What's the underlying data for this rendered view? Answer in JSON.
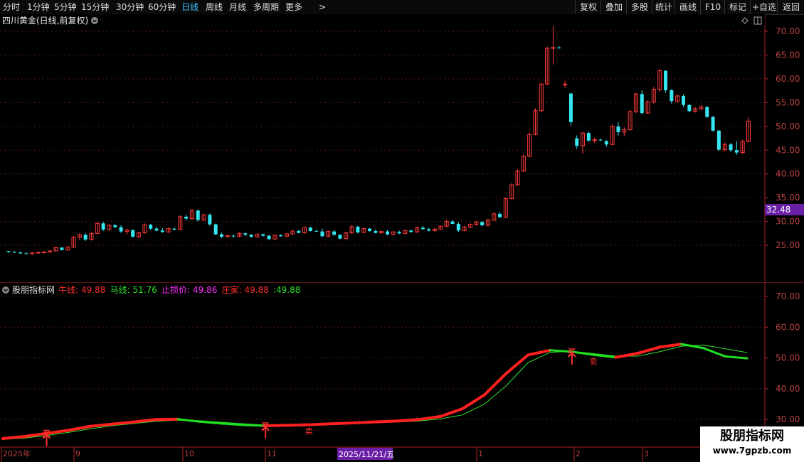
{
  "toolbar": {
    "periods": [
      "分时",
      "1分钟",
      "5分钟",
      "15分钟",
      "30分钟",
      "60分钟",
      "日线",
      "周线",
      "月线",
      "多周期",
      "更多"
    ],
    "active_period": "日线",
    "more_arrow": ">",
    "right_buttons": [
      "复权",
      "叠加",
      "多股",
      "统计",
      "画线",
      "F10",
      "+自选",
      "返回"
    ],
    "annotation_button": "标记"
  },
  "main_chart": {
    "title": "四川黄金(日线,前复权)",
    "price_label": "32.48",
    "y_ticks": [
      "70.00",
      "65.00",
      "60.00",
      "55.00",
      "50.00",
      "45.00",
      "40.00",
      "35.00",
      "30.00",
      "25.00"
    ],
    "colors": {
      "up": "#ff3b3b",
      "down": "#35e6f0",
      "grid": "#5a1515",
      "axis": "#b22222",
      "price_bg": "#6a1fa6"
    }
  },
  "indicator": {
    "name": "股朋指标网",
    "items": [
      {
        "label": "牛线:",
        "value": "49.88",
        "color": "#ff3030"
      },
      {
        "label": "马线:",
        "value": "51.76",
        "color": "#30e030"
      },
      {
        "label": "止损价:",
        "value": "49.86",
        "color": "#ff30ff"
      },
      {
        "label": "庄家:",
        "value": "49.88",
        "color": "#ff3030"
      },
      {
        "label": ":",
        "value": "49.88",
        "color": "#30e030"
      }
    ],
    "y_ticks": [
      "70.00",
      "60.00",
      "50.00",
      "40.00",
      "30.00"
    ],
    "buy_marks": [
      "买",
      "买",
      "买"
    ],
    "sell_marks": [
      "卖",
      "卖"
    ]
  },
  "x_axis": {
    "labels": [
      "2025年",
      "9",
      "10",
      "11",
      "1",
      "2",
      "3"
    ],
    "cursor_label": "2025/11/21/五"
  },
  "watermark": {
    "title": "股朋指标网",
    "url": "www.7gpzb.com"
  },
  "chart_data": [
    {
      "type": "candlestick",
      "title": "四川黄金(日线,前复权)",
      "x_labels": [
        "2025年",
        "9",
        "10",
        "11",
        "1",
        "2",
        "3"
      ],
      "ylim": [
        20,
        75
      ],
      "y_ticks": [
        25,
        30,
        35,
        40,
        45,
        50,
        55,
        60,
        65,
        70
      ],
      "last_price": 32.48,
      "candles": [
        [
          23.8,
          23.8,
          23.4,
          23.6
        ],
        [
          23.6,
          23.8,
          23.4,
          23.5
        ],
        [
          23.5,
          23.6,
          23.2,
          23.3
        ],
        [
          23.3,
          23.5,
          23.1,
          23.2
        ],
        [
          23.2,
          23.5,
          23.1,
          23.4
        ],
        [
          23.4,
          23.6,
          23.2,
          23.5
        ],
        [
          23.5,
          23.7,
          23.3,
          23.6
        ],
        [
          23.6,
          23.9,
          23.4,
          23.8
        ],
        [
          23.8,
          24.6,
          23.7,
          24.5
        ],
        [
          24.5,
          24.6,
          23.9,
          24.0
        ],
        [
          24.0,
          24.8,
          23.9,
          24.6
        ],
        [
          24.6,
          26.9,
          24.5,
          26.7
        ],
        [
          26.7,
          27.5,
          26.1,
          27.2
        ],
        [
          27.2,
          27.5,
          25.9,
          26.2
        ],
        [
          26.2,
          27.7,
          26.0,
          27.5
        ],
        [
          27.5,
          29.9,
          27.3,
          29.6
        ],
        [
          29.6,
          29.9,
          28.0,
          28.3
        ],
        [
          28.3,
          29.4,
          28.1,
          29.2
        ],
        [
          29.2,
          29.5,
          28.6,
          28.8
        ],
        [
          28.8,
          29.2,
          27.6,
          27.9
        ],
        [
          27.9,
          28.5,
          27.3,
          28.2
        ],
        [
          28.2,
          28.3,
          26.6,
          26.8
        ],
        [
          26.8,
          27.8,
          26.5,
          27.6
        ],
        [
          27.6,
          29.6,
          27.4,
          29.3
        ],
        [
          29.3,
          29.5,
          28.2,
          28.5
        ],
        [
          28.5,
          28.9,
          27.9,
          28.1
        ],
        [
          28.1,
          28.6,
          27.6,
          27.8
        ],
        [
          27.8,
          28.7,
          27.6,
          28.5
        ],
        [
          28.5,
          28.7,
          28.1,
          28.3
        ],
        [
          28.3,
          31.3,
          28.2,
          31.0
        ],
        [
          31.0,
          31.4,
          30.2,
          30.6
        ],
        [
          30.6,
          32.6,
          30.4,
          32.3
        ],
        [
          32.3,
          32.5,
          30.0,
          30.3
        ],
        [
          30.3,
          31.6,
          30.1,
          31.4
        ],
        [
          31.4,
          31.7,
          29.1,
          29.4
        ],
        [
          29.4,
          29.6,
          27.1,
          27.3
        ],
        [
          27.3,
          27.7,
          26.5,
          26.8
        ],
        [
          26.8,
          27.2,
          26.6,
          27.0
        ],
        [
          27.0,
          27.3,
          26.6,
          26.9
        ],
        [
          26.9,
          27.7,
          26.7,
          27.5
        ],
        [
          27.5,
          27.7,
          26.9,
          27.2
        ],
        [
          27.2,
          27.3,
          26.6,
          26.8
        ],
        [
          26.8,
          27.5,
          26.6,
          27.3
        ],
        [
          27.3,
          27.5,
          26.8,
          27.0
        ],
        [
          27.0,
          27.2,
          26.1,
          26.3
        ],
        [
          26.3,
          27.3,
          26.2,
          27.1
        ],
        [
          27.1,
          27.3,
          26.8,
          26.9
        ],
        [
          26.9,
          27.6,
          26.7,
          27.4
        ],
        [
          27.4,
          28.2,
          27.2,
          28.0
        ],
        [
          28.0,
          28.2,
          27.5,
          27.6
        ],
        [
          27.6,
          28.9,
          27.4,
          28.7
        ],
        [
          28.7,
          28.9,
          27.9,
          28.0
        ],
        [
          28.0,
          28.3,
          27.8,
          27.9
        ],
        [
          27.9,
          28.5,
          26.7,
          26.9
        ],
        [
          26.9,
          28.1,
          26.7,
          27.9
        ],
        [
          27.9,
          28.2,
          27.0,
          27.2
        ],
        [
          27.2,
          27.3,
          26.2,
          26.4
        ],
        [
          26.4,
          27.8,
          26.2,
          27.6
        ],
        [
          27.6,
          29.3,
          27.4,
          28.9
        ],
        [
          28.9,
          29.1,
          27.5,
          27.7
        ],
        [
          27.7,
          28.7,
          27.5,
          28.5
        ],
        [
          28.5,
          28.6,
          27.8,
          28.0
        ],
        [
          28.0,
          28.3,
          27.5,
          27.6
        ],
        [
          27.6,
          28.1,
          27.4,
          27.9
        ],
        [
          27.9,
          28.2,
          27.1,
          27.3
        ],
        [
          27.3,
          28.0,
          27.1,
          27.8
        ],
        [
          27.8,
          28.1,
          27.3,
          27.5
        ],
        [
          27.5,
          28.3,
          27.3,
          28.1
        ],
        [
          28.1,
          28.3,
          27.6,
          27.8
        ],
        [
          27.8,
          28.9,
          27.6,
          28.7
        ],
        [
          28.7,
          29.0,
          28.2,
          28.4
        ],
        [
          28.4,
          28.7,
          27.9,
          28.1
        ],
        [
          28.1,
          28.6,
          27.8,
          28.4
        ],
        [
          28.4,
          29.2,
          28.2,
          29.0
        ],
        [
          29.0,
          30.4,
          28.8,
          30.0
        ],
        [
          30.0,
          30.3,
          29.4,
          29.5
        ],
        [
          29.5,
          29.9,
          27.8,
          28.1
        ],
        [
          28.1,
          29.1,
          27.9,
          28.8
        ],
        [
          28.8,
          29.6,
          28.6,
          29.4
        ],
        [
          29.4,
          30.1,
          29.1,
          29.9
        ],
        [
          29.9,
          30.1,
          29.0,
          29.2
        ],
        [
          29.2,
          30.6,
          29.0,
          30.3
        ],
        [
          30.3,
          31.9,
          30.1,
          31.6
        ],
        [
          31.6,
          32.0,
          30.7,
          30.9
        ],
        [
          30.9,
          35.1,
          30.7,
          34.8
        ],
        [
          34.8,
          38.1,
          34.6,
          37.7
        ],
        [
          37.7,
          41.0,
          37.5,
          40.6
        ],
        [
          40.6,
          44.1,
          40.4,
          43.7
        ],
        [
          43.7,
          48.7,
          43.5,
          48.3
        ],
        [
          48.3,
          53.8,
          48.1,
          53.3
        ],
        [
          53.3,
          59.2,
          52.9,
          58.9
        ],
        [
          58.9,
          66.8,
          58.7,
          66.4
        ],
        [
          66.4,
          73.5,
          63.0,
          66.6
        ],
        [
          66.6,
          66.9,
          66.3,
          66.5
        ],
        [
          58.7,
          59.6,
          58.1,
          58.9
        ],
        [
          56.9,
          57.1,
          50.2,
          50.9
        ],
        [
          47.5,
          48.1,
          45.3,
          45.9
        ],
        [
          45.9,
          48.9,
          44.2,
          48.6
        ],
        [
          48.6,
          48.9,
          46.8,
          47.0
        ],
        [
          47.0,
          47.6,
          46.5,
          47.2
        ],
        [
          47.2,
          47.4,
          46.9,
          47.1
        ],
        [
          46.9,
          47.1,
          45.7,
          46.2
        ],
        [
          46.2,
          50.4,
          46.0,
          50.0
        ],
        [
          50.0,
          50.9,
          48.1,
          48.8
        ],
        [
          48.8,
          49.8,
          47.9,
          49.3
        ],
        [
          49.3,
          53.5,
          49.1,
          53.1
        ],
        [
          53.1,
          57.1,
          52.8,
          56.8
        ],
        [
          56.8,
          57.6,
          52.5,
          52.8
        ],
        [
          52.8,
          55.5,
          52.6,
          55.1
        ],
        [
          55.1,
          58.3,
          54.8,
          57.8
        ],
        [
          57.8,
          62.1,
          57.3,
          61.7
        ],
        [
          61.7,
          61.8,
          57.1,
          57.6
        ],
        [
          57.6,
          57.9,
          54.8,
          55.3
        ],
        [
          55.3,
          56.7,
          55.1,
          56.4
        ],
        [
          56.4,
          56.7,
          54.1,
          54.5
        ],
        [
          54.5,
          54.7,
          53.0,
          53.2
        ],
        [
          53.2,
          54.0,
          52.9,
          53.7
        ],
        [
          53.7,
          54.5,
          53.4,
          54.1
        ],
        [
          54.1,
          54.2,
          51.8,
          52.0
        ],
        [
          52.0,
          52.2,
          48.9,
          49.1
        ],
        [
          49.1,
          49.3,
          44.8,
          45.1
        ],
        [
          45.1,
          46.6,
          44.7,
          46.2
        ],
        [
          46.2,
          46.5,
          44.6,
          45.0
        ],
        [
          45.0,
          46.9,
          44.0,
          44.5
        ],
        [
          44.5,
          47.2,
          44.2,
          46.8
        ],
        [
          46.8,
          51.9,
          46.6,
          51.1
        ]
      ]
    },
    {
      "type": "line",
      "title": "股朋指标网",
      "ylim": [
        25,
        75
      ],
      "y_ticks": [
        30,
        40,
        50,
        60,
        70
      ],
      "series": [
        {
          "name": "牛线",
          "color": "#ff2020",
          "values": [
            23.8,
            24.5,
            25.5,
            26.5,
            27.8,
            28.5,
            29.2,
            30.0,
            30.1,
            29.3,
            28.7,
            28.2,
            28.0,
            28.1,
            28.3,
            28.6,
            28.9,
            29.2,
            29.5,
            30.0,
            31.0,
            33.5,
            38.0,
            45.0,
            51.0,
            52.5,
            52.0,
            51.0,
            50.2,
            51.5,
            53.5,
            54.5,
            53.2,
            50.5,
            49.88
          ]
        },
        {
          "name": "马线",
          "color": "#30e030",
          "values": [
            23.5,
            24.0,
            24.8,
            25.8,
            27.0,
            28.0,
            28.7,
            29.4,
            29.8,
            29.6,
            29.1,
            28.6,
            28.2,
            28.0,
            28.1,
            28.4,
            28.7,
            29.0,
            29.2,
            29.5,
            30.2,
            31.5,
            35.0,
            41.0,
            48.5,
            51.8,
            52.2,
            51.4,
            50.6,
            50.6,
            52.0,
            53.8,
            54.2,
            53.0,
            51.76
          ]
        }
      ]
    }
  ]
}
